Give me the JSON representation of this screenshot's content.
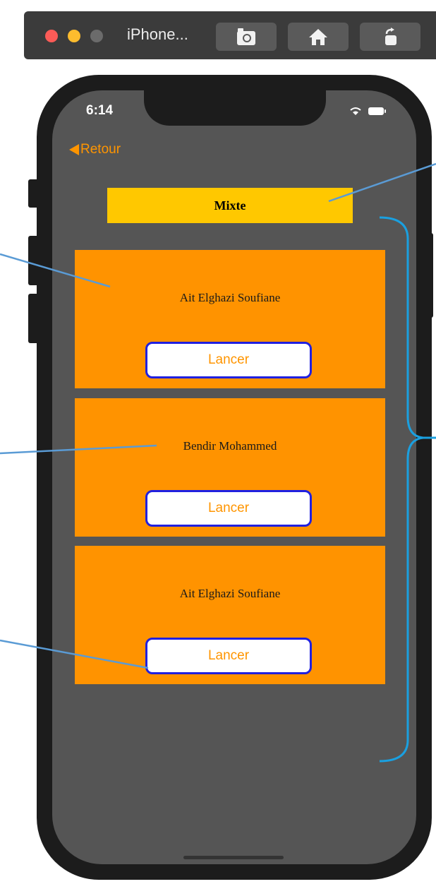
{
  "simulator": {
    "title": "iPhone...",
    "toolbar_icons": [
      "screenshot-icon",
      "home-icon",
      "rotate-icon"
    ]
  },
  "status_bar": {
    "time": "6:14"
  },
  "nav": {
    "back_label": "Retour"
  },
  "header": {
    "title": "Mixte"
  },
  "players": [
    {
      "name": "Ait Elghazi Soufiane",
      "button_label": "Lancer"
    },
    {
      "name": "Bendir Mohammed",
      "button_label": "Lancer"
    },
    {
      "name": "Ait Elghazi Soufiane",
      "button_label": "Lancer"
    }
  ],
  "colors": {
    "screen_bg": "#555555",
    "accent_orange": "#ff9500",
    "card_orange": "#ff9300",
    "title_yellow": "#ffc800",
    "button_border": "#2020e0",
    "annotation_line": "#5a9bd5",
    "bracket": "#1aa0e0"
  }
}
